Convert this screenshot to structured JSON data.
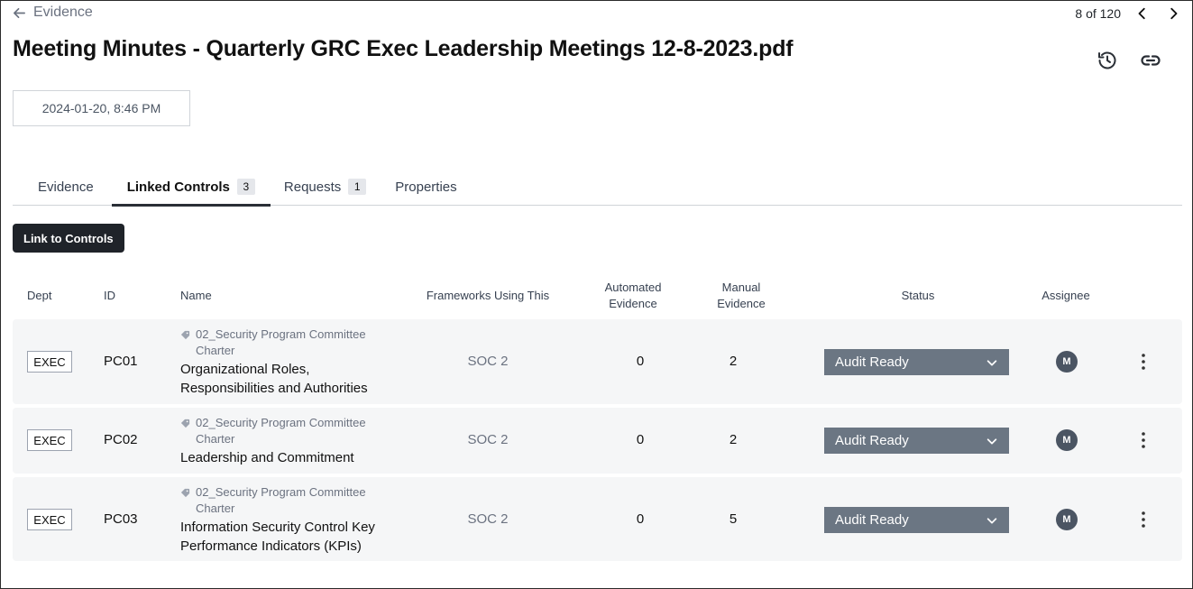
{
  "nav": {
    "back_label": "Evidence",
    "pager_text": "8 of 120"
  },
  "page": {
    "title": "Meeting Minutes - Quarterly GRC Exec Leadership Meetings 12-8-2023.pdf",
    "date": "2024-01-20, 8:46 PM"
  },
  "tabs": [
    {
      "label": "Evidence",
      "count": null,
      "active": false
    },
    {
      "label": "Linked Controls",
      "count": "3",
      "active": true
    },
    {
      "label": "Requests",
      "count": "1",
      "active": false
    },
    {
      "label": "Properties",
      "count": null,
      "active": false
    }
  ],
  "actions": {
    "link_label": "Link to Controls"
  },
  "table": {
    "headers": {
      "dept": "Dept",
      "id": "ID",
      "name": "Name",
      "frameworks": "Frameworks Using This",
      "automated_1": "Automated",
      "automated_2": "Evidence",
      "manual_1": "Manual",
      "manual_2": "Evidence",
      "status": "Status",
      "assignee": "Assignee"
    },
    "rows": [
      {
        "dept": "EXEC",
        "id": "PC01",
        "parent_1": "02_Security Program Committee",
        "parent_2": "Charter",
        "name_1": "Organizational Roles,",
        "name_2": "Responsibilities and Authorities",
        "framework": "SOC 2",
        "automated": "0",
        "manual": "2",
        "status": "Audit Ready",
        "assignee": "M"
      },
      {
        "dept": "EXEC",
        "id": "PC02",
        "parent_1": "02_Security Program Committee",
        "parent_2": "Charter",
        "name_1": "Leadership and Commitment",
        "name_2": "",
        "framework": "SOC 2",
        "automated": "0",
        "manual": "2",
        "status": "Audit Ready",
        "assignee": "M"
      },
      {
        "dept": "EXEC",
        "id": "PC03",
        "parent_1": "02_Security Program Committee",
        "parent_2": "Charter",
        "name_1": "Information Security Control Key",
        "name_2": "Performance Indicators (KPIs)",
        "framework": "SOC 2",
        "automated": "0",
        "manual": "5",
        "status": "Audit Ready",
        "assignee": "M"
      }
    ]
  },
  "icons": {
    "back": "arrow-left-icon",
    "prev": "chevron-left-icon",
    "next": "chevron-right-icon",
    "history": "history-icon",
    "link": "link-icon",
    "parent": "tag-icon",
    "dropdown": "chevron-down-icon",
    "more": "more-vertical-icon"
  },
  "colors": {
    "primary_button": "#1f2329",
    "status_select": "#6b7683",
    "row_background": "#f5f6f7",
    "avatar": "#4b5563"
  }
}
